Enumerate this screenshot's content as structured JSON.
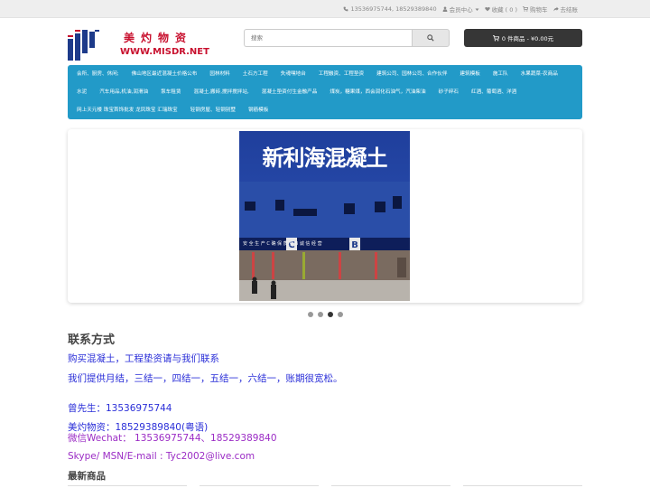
{
  "topbar": {
    "phone": "13536975744, 18529389840",
    "account": "会员中心",
    "wishlist": "收藏 ( 0 )",
    "cart": "购物车",
    "checkout": "去结账"
  },
  "logo": {
    "chinese": "美灼物资",
    "english": "WWW.MISDR.NET"
  },
  "search": {
    "placeholder": "搜索"
  },
  "cart_button": {
    "label": "0 件商品 - ¥0.00元"
  },
  "categories": [
    "会所、厨房、休闲;",
    "佛山地区最近混凝土价格公布",
    "园林材料",
    "土石方工程",
    "失魂嘿地台",
    "工程融资、工程垫资",
    "建筑公司、园林公司、合作伙伴",
    "建筑模板",
    "施工队",
    "水果蔬菜-农商品",
    "水泥",
    "汽车用品,机油,润滑油",
    "泵车租赁",
    "混凝土,搬砖,搅拌搅拌站,",
    "混凝土垫资付生金融产品",
    "煤炭，糖果煤，西会润化石油气，汽油柴油",
    "砂子碎石",
    "红酒、葡萄酒、洋酒",
    "网上天元楼 珠宝首饰批发 龙凤珠宝 汇瑞珠宝",
    "轻钢房屋、轻钢别墅",
    "钢筋模板"
  ],
  "slideshow": {
    "sign_text": "新利海混凝土",
    "strip_text": "安 全 生 产   C  确 保 质 量   B   诚 信 经 营",
    "total_slides": 4,
    "active_slide": 3
  },
  "contact": {
    "heading": "联系方式",
    "line1": "购买混凝土，工程垫资请与我们联系",
    "line2": "我们提供月结，三结一，四结一，五结一，六结一，账期很宽松。",
    "line3": "曾先生：13536975744",
    "line4": "美灼物资：18529389840(粤语)",
    "line5": "微信Wechat： 13536975744、18529389840",
    "line6": "Skype/ MSN/E-mail : Tyc2002@live.com"
  },
  "latest": {
    "heading": "最新商品"
  },
  "colors": {
    "menu_bg": "#229ac8",
    "cart_bg": "#363636",
    "logo_red": "#c8102e",
    "contact_blue": "#2a2ed8",
    "contact_purple": "#9b2cc5"
  },
  "icons": [
    "phone-icon",
    "user-icon",
    "heart-icon",
    "cart-icon",
    "share-icon",
    "search-icon",
    "caret-down-icon"
  ]
}
